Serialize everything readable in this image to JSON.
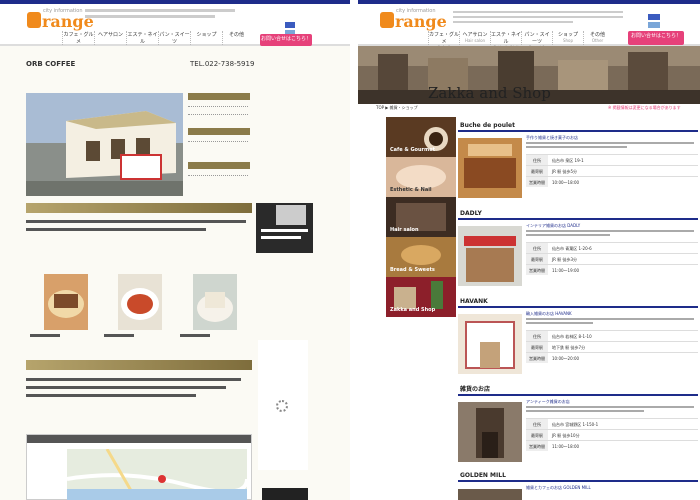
{
  "left": {
    "header": {
      "logo_prefix": "o",
      "logo_text": "range",
      "logo_sub": "city information",
      "nav": [
        {
          "label": "カフェ・グルメ",
          "en": "Cafe & Gourmet"
        },
        {
          "label": "ヘアサロン",
          "en": "Hair salon"
        },
        {
          "label": "エステ・ネイル",
          "en": "Esthetic/Nail"
        },
        {
          "label": "パン・スイーツ",
          "en": "Bread & sweets"
        },
        {
          "label": "ショップ",
          "en": "Shop"
        },
        {
          "label": "その他",
          "en": "Other"
        }
      ],
      "cta": "お問い合せはこちら！"
    },
    "shop_name": "ORB COFFEE",
    "tel": "TEL.022-738-5919",
    "ad_text": "ORB COFFEE"
  },
  "right": {
    "header": {
      "logo_prefix": "o",
      "logo_text": "range",
      "logo_sub": "city information",
      "nav": [
        {
          "label": "カフェ・グルメ",
          "en": "Cafe & Gourmet"
        },
        {
          "label": "ヘアサロン",
          "en": "Hair salon"
        },
        {
          "label": "エステ・ネイル",
          "en": "Esthetic/Nail"
        },
        {
          "label": "パン・スイーツ",
          "en": "Bread & sweets"
        },
        {
          "label": "ショップ",
          "en": "Shop"
        },
        {
          "label": "その他",
          "en": "Other"
        }
      ],
      "cta": "お問い合せはこちら！"
    },
    "banner_title": "Zakka and Shop",
    "breadcrumb": "TOP ▶ 雑貨・ショップ",
    "notice": "※ 掲載情報は変更になる場合があります",
    "categories": [
      {
        "label": "Cafe & Gourmet",
        "color": "#5a3a22"
      },
      {
        "label": "Esthetic & Nail",
        "color": "#d9b79a"
      },
      {
        "label": "Hair salon",
        "color": "#3c2c22"
      },
      {
        "label": "Bread & Sweets",
        "color": "#a87a3e"
      },
      {
        "label": "Zakka and Shop",
        "color": "#8c1f2a"
      }
    ],
    "shops": [
      {
        "name": "Buche de poulet",
        "link": "手作り雑貨と焼き菓子のお店",
        "rows": [
          [
            "住所",
            "仙台市 泉区 19-1"
          ],
          [
            "最寄駅",
            "JR 駅 徒歩5分"
          ],
          [
            "営業時間",
            "10:00〜18:00"
          ]
        ]
      },
      {
        "name": "DADLY",
        "link": "インテリア雑貨のお店 DADLY",
        "rows": [
          [
            "住所",
            "仙台市 青葉区 1-20-6"
          ],
          [
            "最寄駅",
            "JR 駅 徒歩3分"
          ],
          [
            "営業時間",
            "11:00〜19:00"
          ]
        ]
      },
      {
        "name": "HAVANK",
        "link": "輸入雑貨のお店 HAVANK",
        "rows": [
          [
            "住所",
            "仙台市 若林区 8-1-10"
          ],
          [
            "最寄駅",
            "地下鉄 駅 徒歩7分"
          ],
          [
            "営業時間",
            "10:00〜20:00"
          ]
        ]
      },
      {
        "name": "雑貨のお店",
        "link": "アンティーク雑貨のお店",
        "rows": [
          [
            "住所",
            "仙台市 宮城野区 1-150-1"
          ],
          [
            "最寄駅",
            "JR 駅 徒歩10分"
          ],
          [
            "営業時間",
            "11:00〜18:00"
          ]
        ]
      },
      {
        "name": "GOLDEN MILL",
        "link": "雑貨とカフェのお店 GOLDEN MILL",
        "rows": []
      }
    ]
  }
}
